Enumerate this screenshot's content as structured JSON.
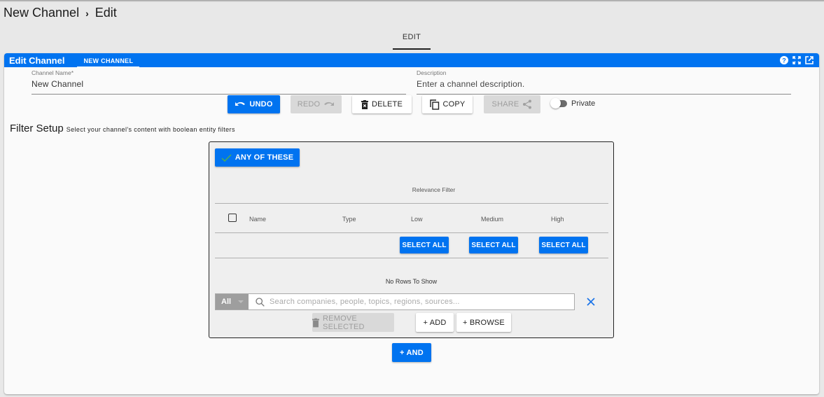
{
  "breadcrumb": {
    "parent": "New Channel",
    "separator": "›",
    "current": "Edit"
  },
  "tabs": [
    {
      "label": "EDIT",
      "active": true
    }
  ],
  "card": {
    "title": "Edit Channel",
    "tab_label": "NEW CHANNEL",
    "header_icons": [
      "help-icon",
      "fullscreen-icon",
      "open-external-icon"
    ],
    "accent_color": "#0073f0"
  },
  "form": {
    "channel_name": {
      "label": "Channel Name*",
      "value": "New Channel"
    },
    "description": {
      "label": "Description",
      "value": "",
      "placeholder": "Enter a channel description."
    }
  },
  "toolbar": {
    "undo": "UNDO",
    "redo": "REDO",
    "delete": "DELETE",
    "copy": "COPY",
    "share": "SHARE",
    "private_label": "Private",
    "private_on": false
  },
  "filter_setup": {
    "title": "Filter Setup",
    "subtitle": "Select your channel's content with boolean entity filters",
    "mode_button": "ANY OF THESE",
    "relevance_header": "Relevance Filter",
    "columns": [
      "Name",
      "Type",
      "Low",
      "Medium",
      "High"
    ],
    "select_all": [
      "SELECT ALL",
      "SELECT ALL",
      "SELECT ALL"
    ],
    "empty_message": "No Rows To Show",
    "search": {
      "type_selected": "All",
      "placeholder": "Search companies, people, topics, regions, sources...",
      "value": ""
    },
    "remove_selected": "REMOVE SELECTED",
    "add": "+ ADD",
    "browse": "+ BROWSE"
  },
  "and_button": "+ AND"
}
